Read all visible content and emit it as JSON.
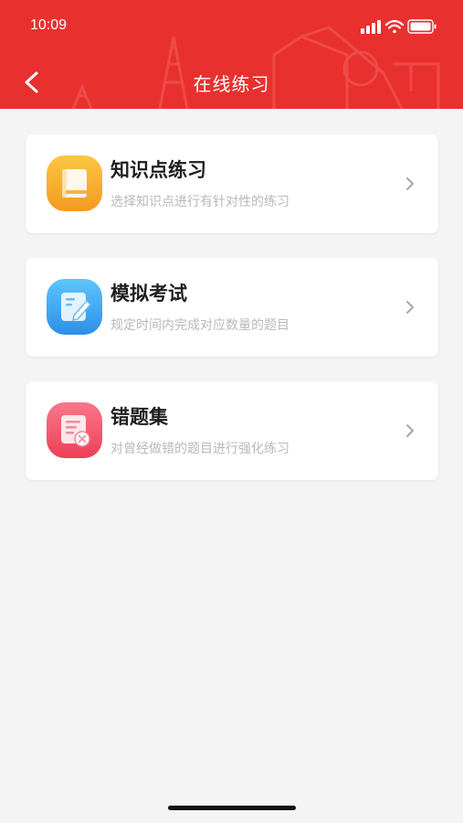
{
  "status_bar": {
    "time": "10:09"
  },
  "header": {
    "title": "在线练习",
    "back_icon": "chevron-left-icon"
  },
  "colors": {
    "header_bg": "#e8302f",
    "icon_orange": "#f5a623",
    "icon_blue": "#3aa7f0",
    "icon_pink": "#f0566b"
  },
  "menu": [
    {
      "title": "知识点练习",
      "subtitle": "选择知识点进行有针对性的练习",
      "icon": "book-icon"
    },
    {
      "title": "模拟考试",
      "subtitle": "规定时间内完成对应数量的题目",
      "icon": "exam-pencil-icon"
    },
    {
      "title": "错题集",
      "subtitle": "对曾经做错的题目进行强化练习",
      "icon": "wrong-answer-icon"
    }
  ]
}
